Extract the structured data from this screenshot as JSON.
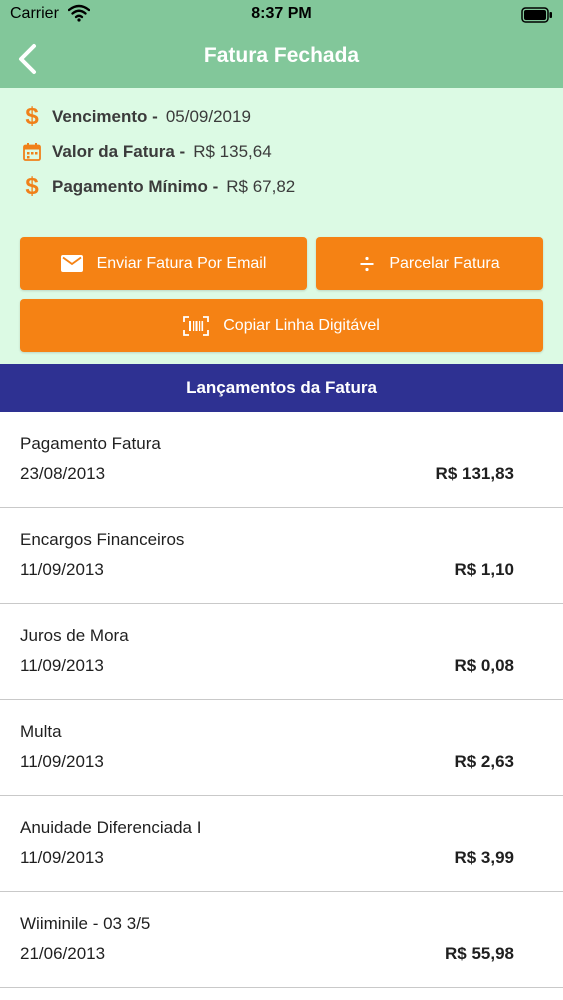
{
  "status": {
    "carrier": "Carrier",
    "time": "8:37 PM"
  },
  "nav": {
    "title": "Fatura Fechada"
  },
  "summary": {
    "vencimento": {
      "label": "Vencimento -",
      "value": "05/09/2019"
    },
    "valor": {
      "label": "Valor da Fatura -",
      "value": "R$ 135,64"
    },
    "minimo": {
      "label": "Pagamento Mínimo -",
      "value": "R$ 67,82"
    }
  },
  "buttons": {
    "email": "Enviar Fatura Por Email",
    "parcelar": "Parcelar Fatura",
    "copiar": "Copiar Linha Digitável"
  },
  "section": {
    "title": "Lançamentos da Fatura"
  },
  "transactions": [
    {
      "desc": "Pagamento Fatura",
      "date": "23/08/2013",
      "amount": "R$ 131,83"
    },
    {
      "desc": "Encargos Financeiros",
      "date": "11/09/2013",
      "amount": "R$ 1,10"
    },
    {
      "desc": "Juros de Mora",
      "date": "11/09/2013",
      "amount": "R$ 0,08"
    },
    {
      "desc": "Multa",
      "date": "11/09/2013",
      "amount": "R$ 2,63"
    },
    {
      "desc": "Anuidade Diferenciada I",
      "date": "11/09/2013",
      "amount": "R$ 3,99"
    },
    {
      "desc": "Wiiminile - 03 3/5",
      "date": "21/06/2013",
      "amount": "R$ 55,98"
    }
  ],
  "colors": {
    "nav": "#82c79a",
    "summary_bg": "#dcfae4",
    "accent": "#f58214",
    "section": "#2e3192"
  },
  "icons": [
    "wifi-icon",
    "battery-icon",
    "back-chevron-icon",
    "dollar-icon",
    "calendar-icon",
    "email-icon",
    "divide-icon",
    "barcode-icon"
  ]
}
